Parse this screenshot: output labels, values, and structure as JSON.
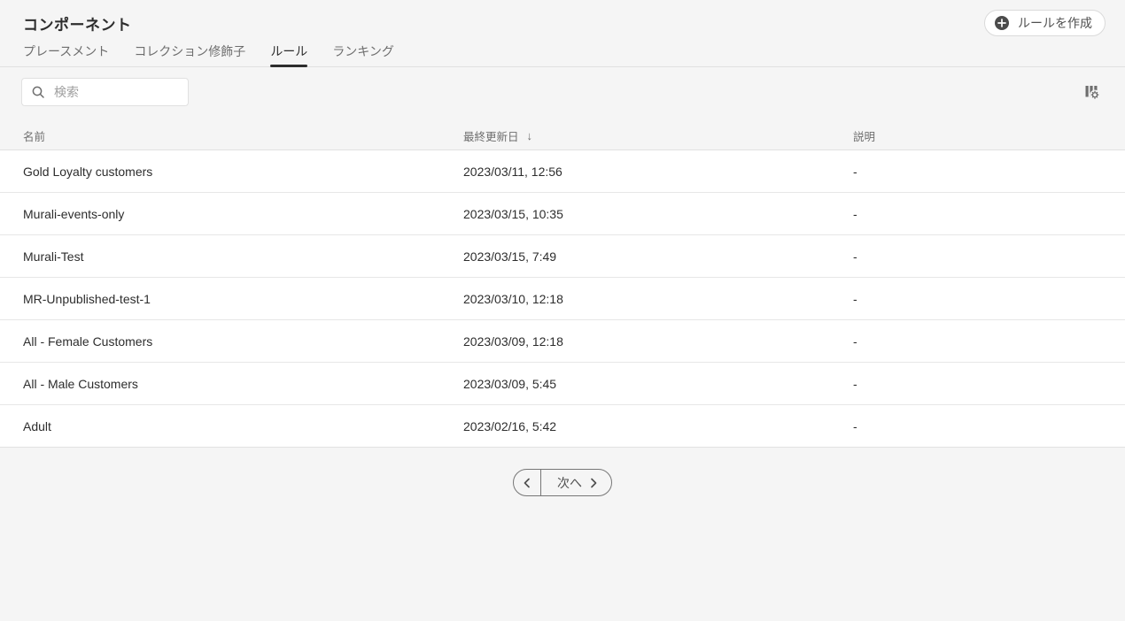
{
  "page": {
    "title": "コンポーネント"
  },
  "header": {
    "create_button_label": "ルールを作成"
  },
  "tabs": [
    {
      "label": "プレースメント",
      "active": false
    },
    {
      "label": "コレクション修飾子",
      "active": false
    },
    {
      "label": "ルール",
      "active": true
    },
    {
      "label": "ランキング",
      "active": false
    }
  ],
  "toolbar": {
    "search_placeholder": "検索"
  },
  "table": {
    "columns": [
      {
        "label": "名前"
      },
      {
        "label": "最終更新日",
        "sort": "desc",
        "sort_icon": "↓"
      },
      {
        "label": "説明"
      }
    ],
    "rows": [
      {
        "name": "Gold Loyalty customers",
        "updated": "2023/03/11, 12:56",
        "description": "-"
      },
      {
        "name": "Murali-events-only",
        "updated": "2023/03/15, 10:35",
        "description": "-"
      },
      {
        "name": "Murali-Test",
        "updated": "2023/03/15, 7:49",
        "description": "-"
      },
      {
        "name": "MR-Unpublished-test-1",
        "updated": "2023/03/10, 12:18",
        "description": "-"
      },
      {
        "name": "All - Female Customers",
        "updated": "2023/03/09, 12:18",
        "description": "-"
      },
      {
        "name": "All - Male Customers",
        "updated": "2023/03/09, 5:45",
        "description": "-"
      },
      {
        "name": "Adult",
        "updated": "2023/02/16, 5:42",
        "description": "-"
      }
    ]
  },
  "pagination": {
    "next_label": "次へ"
  },
  "colors": {
    "page_background": "#f5f5f5",
    "row_background": "#ffffff",
    "border": "#e1e1e1",
    "text_primary": "#2d2d2d",
    "text_secondary": "#6e6e6e",
    "active_tab_underline": "#2d2d2d",
    "icon_gray": "#6e6e6e"
  }
}
